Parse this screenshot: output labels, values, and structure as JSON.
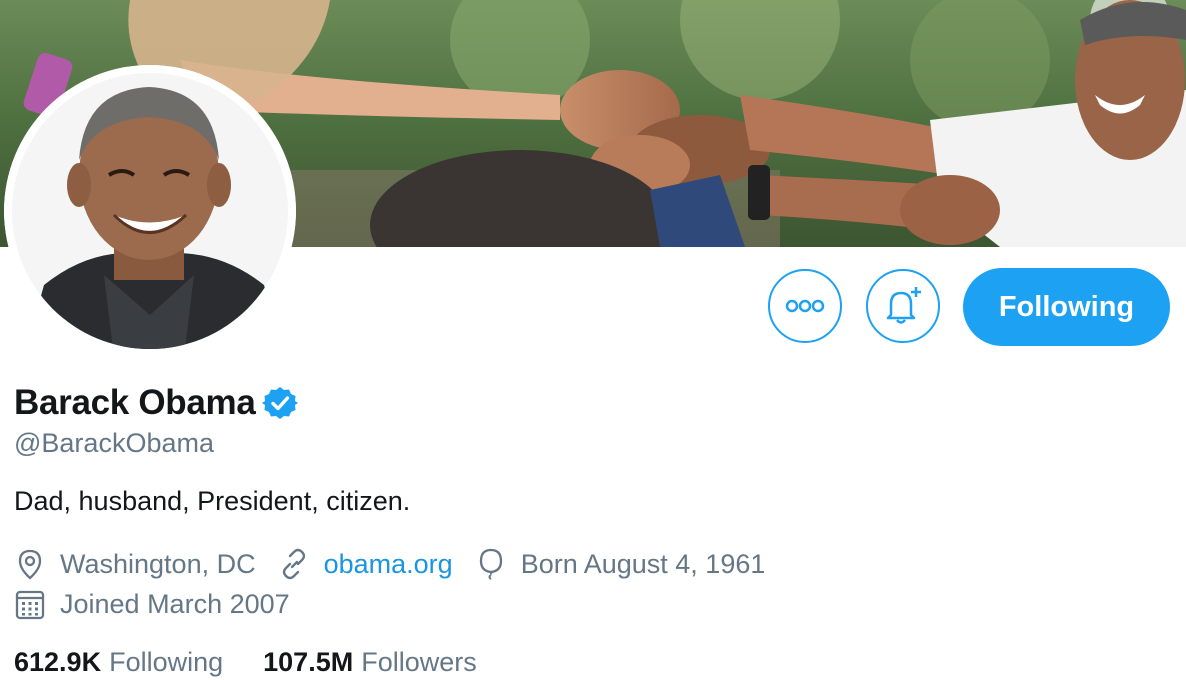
{
  "profile": {
    "name": "Barack Obama",
    "handle": "@BarackObama",
    "bio": "Dad, husband, President, citizen.",
    "location": "Washington, DC",
    "website": "obama.org",
    "birthday": "Born August 4, 1961",
    "joined": "Joined March 2007",
    "verified": true
  },
  "actions": {
    "follow_label": "Following"
  },
  "stats": {
    "following_count": "612.9K",
    "following_label": "Following",
    "followers_count": "107.5M",
    "followers_label": "Followers"
  },
  "icons": {
    "verified": "verified-badge-icon",
    "location": "location-pin-icon",
    "link": "link-icon",
    "birthday": "balloon-icon",
    "joined": "calendar-icon",
    "more": "more-dots-icon",
    "notify": "bell-plus-icon"
  },
  "colors": {
    "accent": "#1da1f2",
    "link": "#1b95e0",
    "text_primary": "#14171a",
    "text_secondary": "#657786"
  }
}
